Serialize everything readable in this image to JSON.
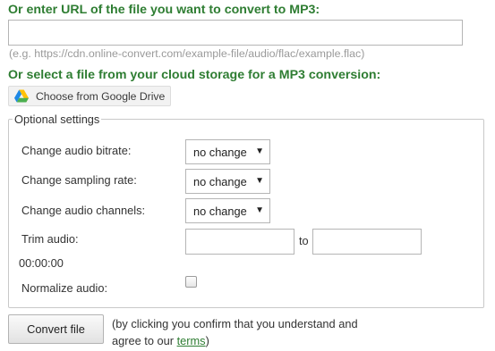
{
  "url_section": {
    "heading": "Or enter URL of the file you want to convert to MP3:",
    "input_value": "",
    "hint": "(e.g. https://cdn.online-convert.com/example-file/audio/flac/example.flac)"
  },
  "cloud_section": {
    "heading": "Or select a file from your cloud storage for a MP3 conversion:",
    "google_drive_button": "Choose from Google Drive",
    "google_drive_icon": "google-drive-icon"
  },
  "optional_settings": {
    "legend": "Optional settings",
    "bitrate": {
      "label": "Change audio bitrate:",
      "value": "no change"
    },
    "sampling": {
      "label": "Change sampling rate:",
      "value": "no change"
    },
    "channels": {
      "label": "Change audio channels:",
      "value": "no change"
    },
    "trim": {
      "label": "Trim audio:",
      "from_value": "",
      "separator": "to",
      "to_value": "",
      "time_display": "00:00:00"
    },
    "normalize": {
      "label": "Normalize audio:",
      "checked": false
    }
  },
  "actions": {
    "convert_button": "Convert file",
    "note_line1": "(by clicking you confirm that you understand and",
    "note_line2_prefix": "agree to our ",
    "terms_link": "terms",
    "note_line2_suffix": ")"
  },
  "colors": {
    "heading_green": "#2e7d32",
    "link_green": "#2e7d32",
    "hint_gray": "#9a9a9a"
  }
}
